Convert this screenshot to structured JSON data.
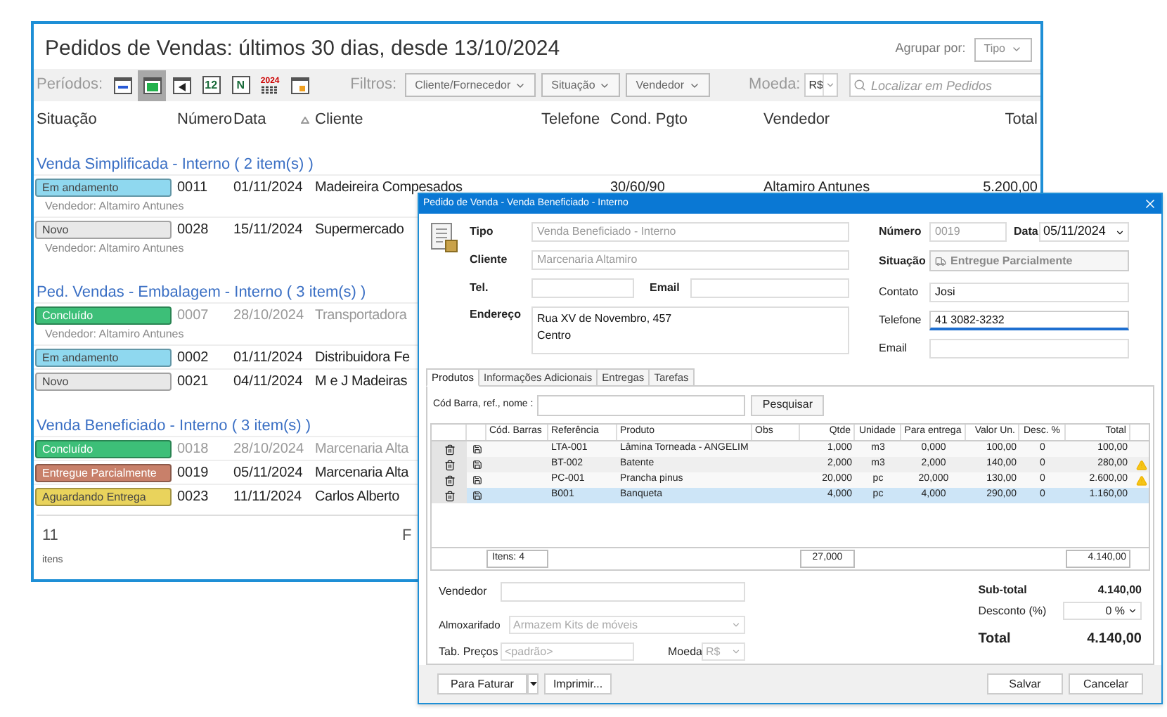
{
  "window": {
    "title": "Pedidos de Vendas: últimos 30 dias, desde 13/10/2024",
    "group_by": {
      "label": "Agrupar por:",
      "value": "Tipo"
    }
  },
  "toolbar": {
    "periods_label": "Períodos:",
    "periods": [
      {
        "kind": "week",
        "selected": false
      },
      {
        "kind": "month",
        "selected": true
      },
      {
        "kind": "previous",
        "selected": false
      },
      {
        "kind": "glyph",
        "glyph": "12",
        "selected": false
      },
      {
        "kind": "glyph",
        "glyph": "N",
        "selected": false
      },
      {
        "kind": "year",
        "glyph": "2024",
        "selected": false
      },
      {
        "kind": "custom",
        "selected": false
      }
    ],
    "filters_label": "Filtros:",
    "filters": [
      "Cliente/Fornecedor",
      "Situação",
      "Vendedor"
    ],
    "currency_label": "Moeda:",
    "currency": "R$",
    "search": {
      "placeholder": "Localizar em Pedidos"
    }
  },
  "columns": [
    "Situação",
    "Número",
    "Data",
    "Cliente",
    "Telefone",
    "Cond. Pgto",
    "Vendedor",
    "Total"
  ],
  "groups": [
    {
      "title": "Venda Simplificada - Interno ( 2 item(s) )",
      "rows": [
        {
          "status": "Em andamento",
          "color": "#8fd8ef",
          "number": "0011",
          "date": "01/11/2024",
          "client": "Madeireira Compesados",
          "terms": "30/60/90",
          "seller": "Altamiro Antunes",
          "total": "5.200,00",
          "dimmed": false,
          "note": "Vendedor: Altamiro Antunes"
        },
        {
          "status": "Novo",
          "color": "#e8e8e8",
          "number": "0028",
          "date": "15/11/2024",
          "client": "Supermercado",
          "dimmed": false,
          "note": "Vendedor: Altamiro Antunes"
        }
      ]
    },
    {
      "title": "Ped. Vendas - Embalagem - Interno ( 3 item(s) )",
      "rows": [
        {
          "status": "Concluído",
          "color": "#3dbf78",
          "number": "0007",
          "date": "28/10/2024",
          "client": "Transportadora",
          "dimmed": true,
          "note": "Vendedor: Altamiro Antunes"
        },
        {
          "status": "Em andamento",
          "color": "#8fd8ef",
          "number": "0002",
          "date": "01/11/2024",
          "client": "Distribuidora Fe",
          "dimmed": false
        },
        {
          "status": "Novo",
          "color": "#e8e8e8",
          "number": "0021",
          "date": "04/11/2024",
          "client": "M e J Madeiras",
          "dimmed": false
        }
      ]
    },
    {
      "title": "Venda Beneficiado - Interno ( 3 item(s) )",
      "rows": [
        {
          "status": "Concluído",
          "color": "#3dbf78",
          "number": "0018",
          "date": "28/10/2024",
          "client": "Marcenaria Alta",
          "dimmed": true
        },
        {
          "status": "Entregue Parcialmente",
          "color": "#c8806a",
          "number": "0019",
          "date": "05/11/2024",
          "client": "Marcenaria Alta",
          "dimmed": false
        },
        {
          "status": "Aguardando Entrega",
          "color": "#e9d35c",
          "number": "0023",
          "date": "11/11/2024",
          "client": "Carlos Alberto",
          "dimmed": false
        }
      ]
    }
  ],
  "footer": {
    "count": "11",
    "label": "itens",
    "column_2": "F"
  },
  "dialog": {
    "title": "Pedido de Venda - Venda Beneficiado - Interno",
    "tipo": {
      "label": "Tipo",
      "value": "Venda Beneficiado - Interno"
    },
    "cliente": {
      "label": "Cliente",
      "value": "Marcenaria Altamiro"
    },
    "tel": {
      "label": "Tel."
    },
    "email": {
      "label": "Email"
    },
    "endereco": {
      "label": "Endereço",
      "lines": [
        "Rua XV de Novembro, 457",
        "Centro"
      ]
    },
    "numero": {
      "label": "Número",
      "value": "0019"
    },
    "data": {
      "label": "Data",
      "value": "05/11/2024"
    },
    "situacao": {
      "label": "Situação",
      "value": "Entregue Parcialmente"
    },
    "contato": {
      "label": "Contato",
      "value": "Josi"
    },
    "telefone": {
      "label": "Telefone",
      "value": "41 3082-3232",
      "focused": true
    },
    "email_contato": {
      "label": "Email"
    },
    "tabs": [
      {
        "label": "Produtos",
        "selected": true
      },
      {
        "label": "Informações Adicionais",
        "selected": false
      },
      {
        "label": "Entregas",
        "selected": false
      },
      {
        "label": "Tarefas",
        "selected": false
      }
    ],
    "search": {
      "label": "Cód Barra, ref., nome :",
      "button": "Pesquisar"
    },
    "table": {
      "columns": [
        "Cód. Barras",
        "Referência",
        "Produto",
        "Obs",
        "Qtde",
        "Unidade",
        "Para entrega",
        "Valor Un.",
        "Desc. %",
        "Total"
      ],
      "rows": [
        {
          "ref": "LTA-001",
          "product": "Lâmina Torneada - ANGELIM",
          "qty": "1,000",
          "unit": "m3",
          "to_deliver": "0,000",
          "unit_price": "100,00",
          "discount": "0",
          "total": "100,00",
          "warning": false,
          "selected": false
        },
        {
          "ref": "BT-002",
          "product": "Batente",
          "qty": "2,000",
          "unit": "m3",
          "to_deliver": "2,000",
          "unit_price": "140,00",
          "discount": "0",
          "total": "280,00",
          "warning": true,
          "selected": false
        },
        {
          "ref": "PC-001",
          "product": "Prancha pinus",
          "qty": "20,000",
          "unit": "pc",
          "to_deliver": "20,000",
          "unit_price": "130,00",
          "discount": "0",
          "total": "2.600,00",
          "warning": true,
          "selected": false
        },
        {
          "ref": "B001",
          "product": "Banqueta",
          "qty": "4,000",
          "unit": "pc",
          "to_deliver": "4,000",
          "unit_price": "290,00",
          "discount": "0",
          "total": "1.160,00",
          "warning": false,
          "selected": true
        }
      ],
      "footer": {
        "items": "Itens: 4",
        "qty": "27,000",
        "total": "4.140,00"
      }
    },
    "vendedor": {
      "label": "Vendedor"
    },
    "almoxarifado": {
      "label": "Almoxarifado",
      "value": "Armazem Kits de móveis"
    },
    "tab_precos": {
      "label": "Tab. Preços",
      "placeholder": "<padrão>"
    },
    "moeda": {
      "label": "Moeda",
      "value": "R$"
    },
    "summary": {
      "subtotal_label": "Sub-total",
      "subtotal": "4.140,00",
      "discount_label": "Desconto (%)",
      "discount": "0 %",
      "total_label": "Total",
      "total": "4.140,00"
    },
    "buttons": {
      "invoice": "Para Faturar",
      "print": "Imprimir...",
      "save": "Salvar",
      "cancel": "Cancelar"
    }
  }
}
